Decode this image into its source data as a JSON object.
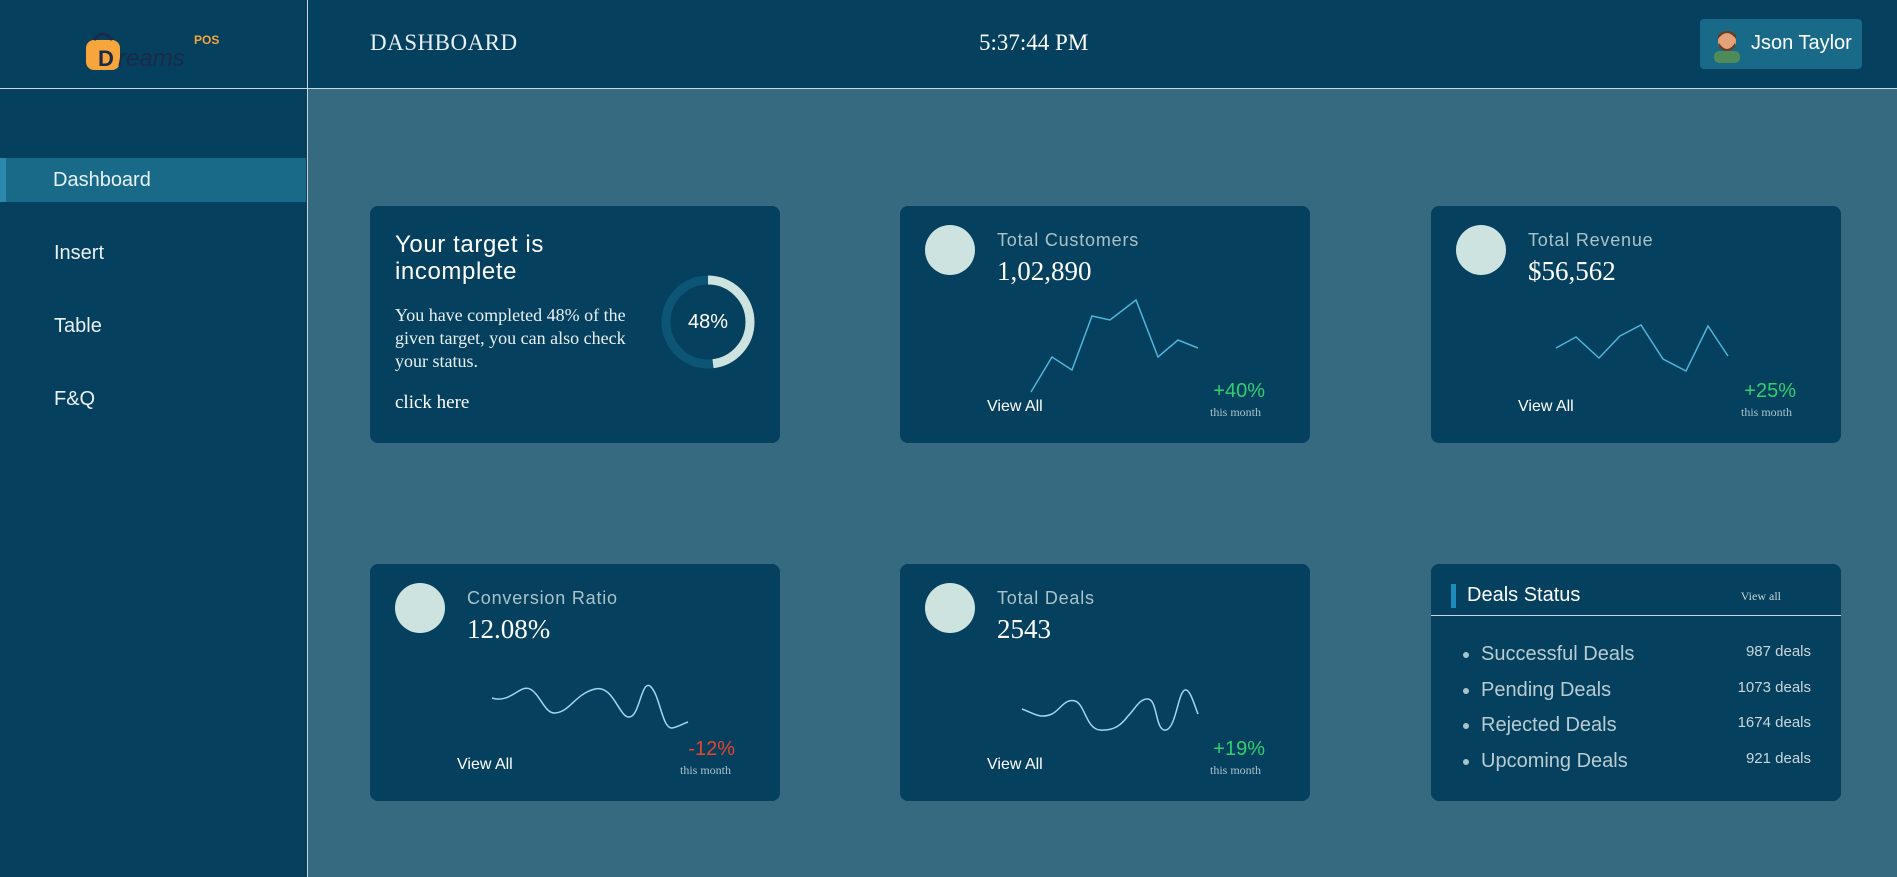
{
  "brand": {
    "logo_text": "Dreams",
    "logo_badge": "POS",
    "accent": "#f7a63c"
  },
  "sidebar": {
    "items": [
      {
        "label": "Dashboard",
        "active": true
      },
      {
        "label": "Insert",
        "active": false
      },
      {
        "label": "Table",
        "active": false
      },
      {
        "label": "F&Q",
        "active": false
      }
    ]
  },
  "header": {
    "title": "DASHBOARD",
    "time": "5:37:44 PM",
    "user_name": "Json Taylor"
  },
  "target_card": {
    "title": "Your target is incomplete",
    "text": "You have completed 48% of the given target, you can also check your status.",
    "link": "click here",
    "progress_percent": 48,
    "progress_label": "48%"
  },
  "cards": {
    "customers": {
      "label": "Total Customers",
      "value": "1,02,890",
      "view_all": "View All",
      "change": "+40%",
      "period": "this month"
    },
    "revenue": {
      "label": "Total Revenue",
      "value": "$56,562",
      "view_all": "View All",
      "change": "+25%",
      "period": "this month"
    },
    "conversion": {
      "label": "Conversion Ratio",
      "value": "12.08%",
      "view_all": "View All",
      "change": "-12%",
      "period": "this month"
    },
    "deals": {
      "label": "Total Deals",
      "value": "2543",
      "view_all": "View All",
      "change": "+19%",
      "period": "this month"
    }
  },
  "deals_status": {
    "title": "Deals Status",
    "view_all": "View all",
    "items": [
      {
        "name": "Successful Deals",
        "count": "987 deals"
      },
      {
        "name": "Pending Deals",
        "count": "1073 deals"
      },
      {
        "name": "Rejected Deals",
        "count": "1674 deals"
      },
      {
        "name": "Upcoming Deals",
        "count": "921 deals"
      }
    ]
  },
  "colors": {
    "sidebar_bg": "#05405e",
    "page_bg": "#366a80",
    "active_nav": "#196a89",
    "positive": "#2fcf6e",
    "negative": "#e8442e",
    "sparkline": "#4fb6d8"
  }
}
